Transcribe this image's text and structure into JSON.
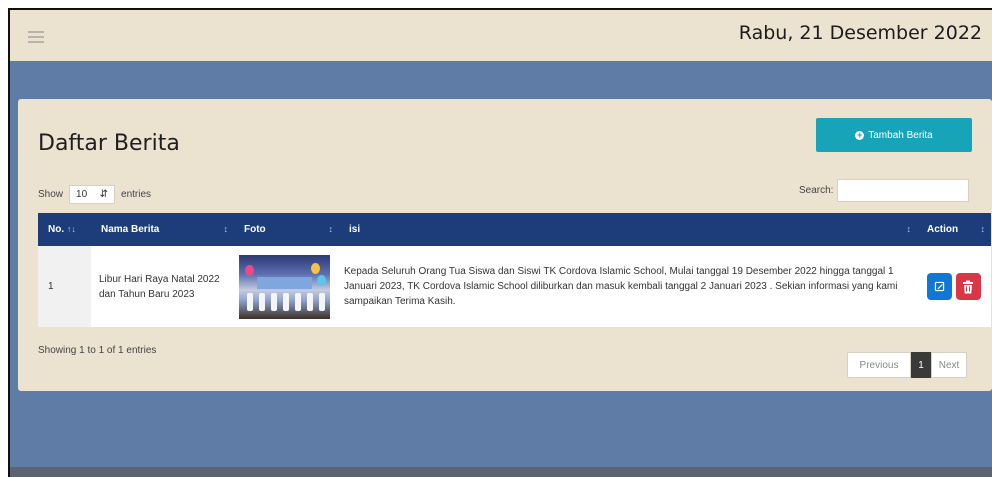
{
  "header": {
    "date": "Rabu, 21 Desember 2022",
    "menu_icon": "hamburger-icon"
  },
  "page": {
    "title": "Daftar Berita",
    "add_button_label": "Tambah Berita",
    "add_button_icon": "plus-circle-icon",
    "accent_color": "#17a3b8",
    "header_color": "#1c3d7a"
  },
  "controls": {
    "show_label": "Show",
    "entries_value": "10",
    "entries_label": "entries",
    "search_label": "Search:",
    "search_value": ""
  },
  "table": {
    "columns": [
      "No.",
      "Nama Berita",
      "Foto",
      "isi",
      "Action"
    ],
    "rows": [
      {
        "no": "1",
        "nama": "Libur Hari Raya Natal 2022 dan Tahun Baru 2023",
        "isi": "Kepada Seluruh Orang Tua Siswa dan Siswi TK Cordova Islamic School, Mulai tanggal 19 Desember 2022 hingga tanggal 1 Januari 2023, TK Cordova Islamic School diliburkan dan masuk kembali tanggal 2 Januari 2023 . Sekian informasi yang kami sampaikan Terima Kasih."
      }
    ]
  },
  "footer": {
    "info": "Showing 1 to 1 of 1 entries",
    "prev": "Previous",
    "current_page": "1",
    "next": "Next"
  }
}
